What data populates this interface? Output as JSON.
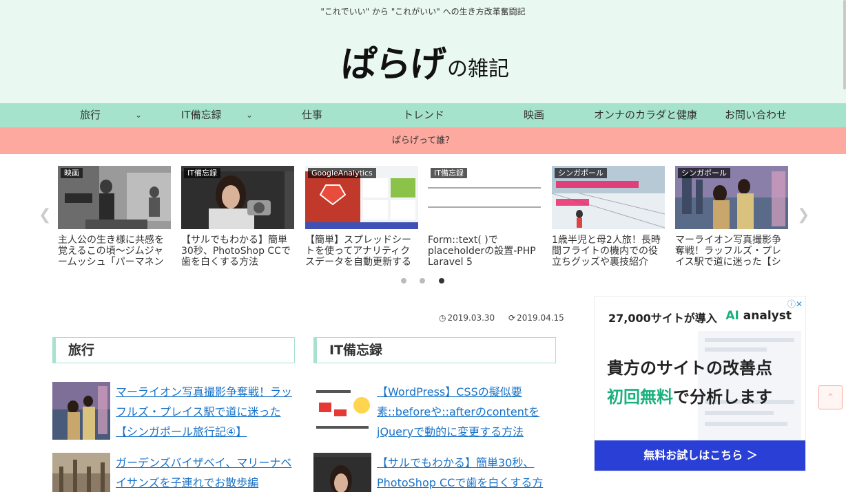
{
  "site": {
    "tagline": "\"これでいい\" から \"これがいい\" への生き方改革奮闘記",
    "logo_main": "ぱらげ",
    "logo_sub": "の雑記"
  },
  "nav": {
    "items": [
      {
        "label": "旅行",
        "has_dropdown": true
      },
      {
        "label": "IT備忘録",
        "has_dropdown": true
      },
      {
        "label": "仕事",
        "has_dropdown": false
      },
      {
        "label": "トレンド",
        "has_dropdown": false
      },
      {
        "label": "映画",
        "has_dropdown": false
      },
      {
        "label": "オンナのカラダと健康",
        "has_dropdown": false
      },
      {
        "label": "お問い合わせ",
        "has_dropdown": false
      }
    ],
    "dropdown_icon": "chevron-down-icon"
  },
  "subnav": {
    "label": "ぱらげって誰？"
  },
  "carousel": {
    "slides": [
      {
        "category": "映画",
        "title": "主人公の生き様に共感を覚えるこの頃〜ジムジャームッシュ「パーマネン"
      },
      {
        "category": "IT備忘録",
        "title": "【サルでもわかる】簡単30秒、PhotoShop CCで歯を白くする方法"
      },
      {
        "category": "GoogleAnalytics",
        "title": "【簡単】スプレッドシートを使ってアナリティクスデータを自動更新する"
      },
      {
        "category": "IT備忘録",
        "title": "Form::text( )でplaceholderの設置-PHP Laravel 5"
      },
      {
        "category": "シンガポール",
        "title": "1歳半児と母2人旅！長時間フライトの機内での役立ちグッズや裏技紹介"
      },
      {
        "category": "シンガポール",
        "title": "マーライオン写真撮影争奪戦！ラッフルズ・プレイス駅で道に迷った【シ"
      }
    ],
    "prev_icon": "chevron-left-icon",
    "next_icon": "chevron-right-icon",
    "pages": 3,
    "active_page": 3
  },
  "meta": {
    "published": "2019.03.30",
    "updated": "2019.04.15"
  },
  "sections": [
    {
      "heading": "旅行",
      "posts": [
        {
          "title": "マーライオン写真撮影争奪戦！ラッフルズ・プレイス駅で道に迷った【シンガポール旅行記④】"
        },
        {
          "title": "ガーデンズバイザベイ、マリーナベイサンズを子連れでお散歩編"
        }
      ]
    },
    {
      "heading": "IT備忘録",
      "posts": [
        {
          "title": "【WordPress】CSSの擬似要素::beforeや::afterのcontentをjQueryで動的に変更する方法"
        },
        {
          "title": "【サルでもわかる】簡単30秒、PhotoShop CCで歯を白くする方"
        }
      ]
    }
  ],
  "ad": {
    "info_icon": "adchoices-icon",
    "top_text": "27,000サイトが導入",
    "brand_ai": "AI",
    "brand_rest": "analyst",
    "line1": "貴方のサイトの改善点",
    "line2_free": "初回無料",
    "line2_rest": "で分析します",
    "cta": "無料お試しはこちら ＞"
  },
  "back_to_top_icon": "chevron-up-icon",
  "colors": {
    "header_bg": "#eaf8f2",
    "nav_bg": "#a6e3cd",
    "subnav_bg": "#fda99f",
    "link": "#1a73c8",
    "ad_cta": "#2a3fd6",
    "ad_accent": "#1ab07e"
  }
}
